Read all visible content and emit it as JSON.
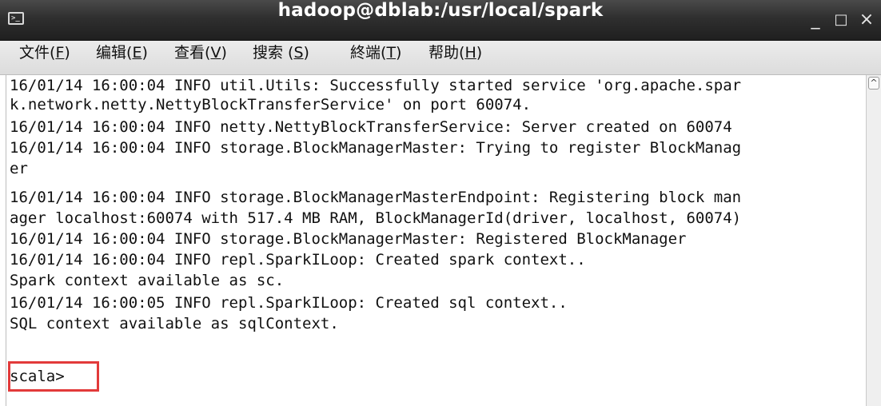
{
  "window": {
    "title": "hadoop@dblab:/usr/local/spark",
    "controls": {
      "minimize": "_",
      "maximize": "□",
      "close": "×"
    },
    "icon": "terminal-icon"
  },
  "menu": [
    {
      "label": "文件",
      "mnemonic": "F"
    },
    {
      "label": "编辑",
      "mnemonic": "E"
    },
    {
      "label": "查看",
      "mnemonic": "V"
    },
    {
      "label": "搜索 ",
      "mnemonic": "S"
    },
    {
      "label": "終端",
      "mnemonic": "T"
    },
    {
      "label": "帮助",
      "mnemonic": "H"
    }
  ],
  "terminal": {
    "lines": [
      "16/01/14 16:00:04 INFO util.Utils: Successfully started service 'org.apache.spar",
      "k.network.netty.NettyBlockTransferService' on port 60074.",
      "16/01/14 16:00:04 INFO netty.NettyBlockTransferService: Server created on 60074",
      "16/01/14 16:00:04 INFO storage.BlockManagerMaster: Trying to register BlockManag",
      "er",
      "16/01/14 16:00:04 INFO storage.BlockManagerMasterEndpoint: Registering block man",
      "ager localhost:60074 with 517.4 MB RAM, BlockManagerId(driver, localhost, 60074)",
      "16/01/14 16:00:04 INFO storage.BlockManagerMaster: Registered BlockManager",
      "16/01/14 16:00:04 INFO repl.SparkILoop: Created spark context..",
      "Spark context available as sc.",
      "16/01/14 16:00:05 INFO repl.SparkILoop: Created sql context..",
      "SQL context available as sqlContext.",
      "",
      "scala>"
    ],
    "highlight_color": "#e23a3a"
  }
}
